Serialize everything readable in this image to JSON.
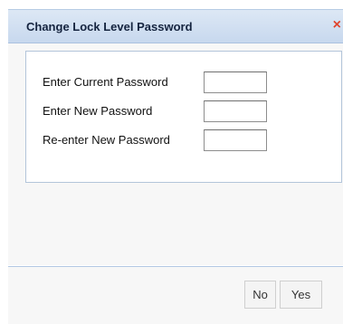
{
  "dialog": {
    "title": "Change Lock Level Password",
    "close_glyph": "×",
    "fields": [
      {
        "label": "Enter Current Password",
        "value": ""
      },
      {
        "label": "Enter New Password",
        "value": ""
      },
      {
        "label": "Re-enter New Password",
        "value": ""
      }
    ],
    "buttons": {
      "no_label": "No",
      "yes_label": "Yes"
    }
  },
  "colors": {
    "title_text": "#15243f",
    "close_icon": "#e0442d",
    "fieldset_border": "#b3c5da"
  },
  "icons": {
    "close": "close-icon"
  }
}
